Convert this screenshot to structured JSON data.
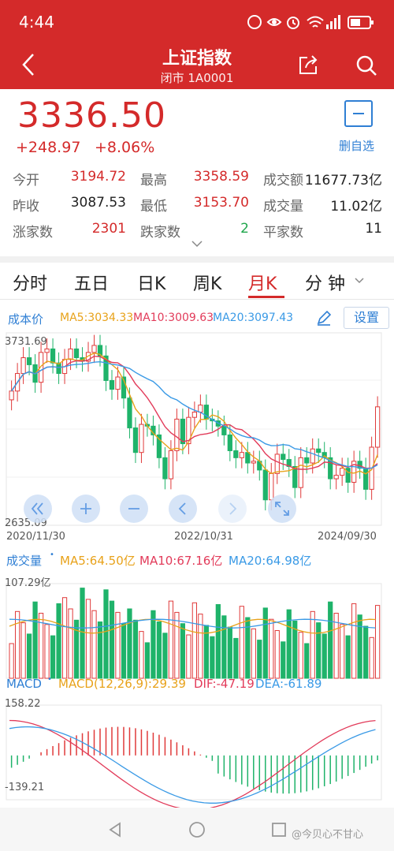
{
  "status": {
    "time": "4:44"
  },
  "header": {
    "title": "上证指数",
    "subtitle": "闭市 1A0001"
  },
  "quote": {
    "price": "3336.50",
    "change": "+248.97",
    "change_pct": "+8.06%",
    "remove_label": "删自选",
    "stats": [
      {
        "label": "今开",
        "value": "3194.72",
        "color": "red"
      },
      {
        "label": "最高",
        "value": "3358.59",
        "color": "red"
      },
      {
        "label": "成交额",
        "value": "11677.73亿",
        "color": "blk"
      },
      {
        "label": "昨收",
        "value": "3087.53",
        "color": "blk"
      },
      {
        "label": "最低",
        "value": "3153.70",
        "color": "red"
      },
      {
        "label": "成交量",
        "value": "11.02亿",
        "color": "blk"
      },
      {
        "label": "涨家数",
        "value": "2301",
        "color": "red"
      },
      {
        "label": "跌家数",
        "value": "2",
        "color": "grn"
      },
      {
        "label": "平家数",
        "value": "11",
        "color": "blk"
      }
    ]
  },
  "tabs": [
    "分时",
    "五日",
    "日K",
    "周K",
    "月K",
    "分 钟"
  ],
  "active_tab": "月K",
  "kline": {
    "cost_label": "成本价",
    "ma5": "MA5:3034.33",
    "ma10": "MA10:3009.63",
    "ma20": "MA20:3097.43",
    "settings_label": "设置",
    "ymax": "3731.69",
    "ymin": "2635.09",
    "dates": [
      "2020/11/30",
      "2022/10/31",
      "2024/09/30"
    ]
  },
  "volume": {
    "title": "成交量",
    "ma5": "MA5:64.50亿",
    "ma10": "MA10:67.16亿",
    "ma20": "MA20:64.98亿",
    "ymax": "107.29亿"
  },
  "macd": {
    "title": "MACD",
    "params": "MACD(12,26,9):29.39",
    "dif": "DIF:-47.19",
    "dea": "DEA:-61.89",
    "ymax": "158.22",
    "ymin": "-139.21"
  },
  "watermark": "@今贝心不甘心",
  "colors": {
    "up": "#e03a3a",
    "down": "#1fb36a",
    "brand": "#d42a2a",
    "blue": "#2f7fd4"
  }
}
